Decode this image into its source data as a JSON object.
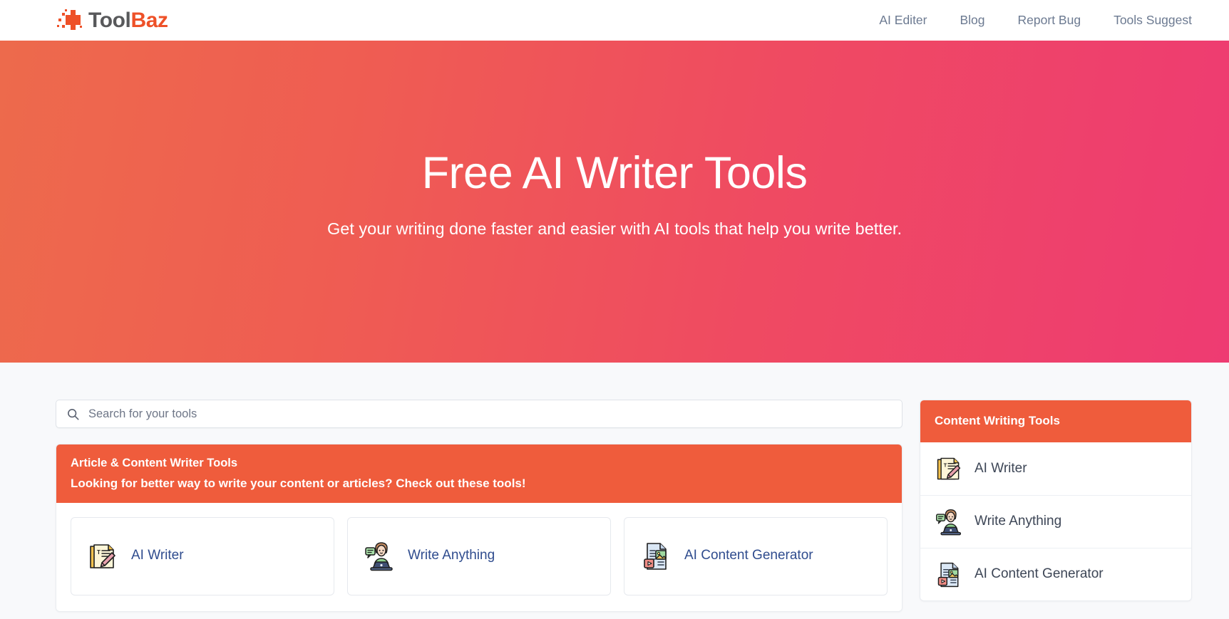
{
  "header": {
    "brand": {
      "icon": "toolbaz-pixel-plus-logo",
      "text_primary": "Tool",
      "text_accent": "Baz"
    },
    "nav": [
      {
        "label": "AI Editer"
      },
      {
        "label": "Blog"
      },
      {
        "label": "Report Bug"
      },
      {
        "label": "Tools Suggest"
      }
    ]
  },
  "hero": {
    "title": "Free AI Writer Tools",
    "subtitle": "Get your writing done faster and easier with AI tools that help you write better."
  },
  "search": {
    "icon": "search-icon",
    "placeholder": "Search for your tools",
    "value": ""
  },
  "section": {
    "title": "Article & Content Writer Tools",
    "subtitle": "Looking for better way to write your content or articles? Check out these tools!",
    "cards": [
      {
        "label": "AI Writer",
        "icon": "memo-pencil-icon"
      },
      {
        "label": "Write Anything",
        "icon": "woman-laptop-icon"
      },
      {
        "label": "AI Content Generator",
        "icon": "document-media-icon"
      }
    ]
  },
  "sidebar": {
    "title": "Content Writing Tools",
    "items": [
      {
        "label": "AI Writer",
        "icon": "memo-pencil-icon"
      },
      {
        "label": "Write Anything",
        "icon": "woman-laptop-icon"
      },
      {
        "label": "AI Content Generator",
        "icon": "document-media-icon"
      }
    ]
  },
  "colors": {
    "brand_orange": "#ee5128",
    "banner_orange": "#ef5c3c",
    "hero_gradient_start": "#ed6a4c",
    "hero_gradient_end": "#ee3b72",
    "link_blue": "#2f4c8e",
    "nav_gray": "#6c7a91",
    "page_bg": "#f8f9fb"
  }
}
